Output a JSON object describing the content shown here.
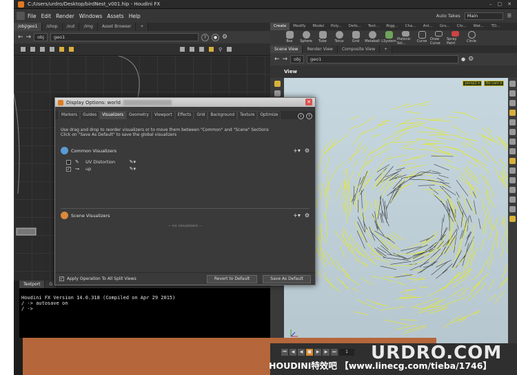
{
  "window": {
    "title": "C:/Users/urdro/Desktop/birdNest_v001.hip - Houdini FX"
  },
  "menu": [
    "File",
    "Edit",
    "Render",
    "Windows",
    "Assets",
    "Help"
  ],
  "top_right": {
    "auto_takes": "Auto Takes",
    "desktop": "Main"
  },
  "left_pane": {
    "tabs": [
      "/obj/geo1",
      "/shop",
      "/out",
      "/img",
      "Asset Browser"
    ],
    "path_obj": "obj",
    "path_geo": "geo1"
  },
  "shelf": {
    "tabs": [
      "Create",
      "Modify",
      "Model",
      "Poly...",
      "Defo...",
      "Text...",
      "Rigg...",
      "Cha...",
      "Anl...",
      "Gro...",
      "Clo...",
      "Wat...",
      "TD..."
    ],
    "tools": [
      "Box",
      "Sphere",
      "Tube",
      "Torus",
      "Grid",
      "Metaball",
      "LSystem",
      "Platonic Sol...",
      "Curve",
      "Draw Curve",
      "Spray Paint",
      "Circle"
    ]
  },
  "right_pane": {
    "tabs": [
      "Scene View",
      "Render View",
      "Composite View"
    ],
    "path_obj": "obj",
    "path_geo": "geo1",
    "view_label": "View",
    "cam_badges": [
      "persp1 ▾",
      "No cam ▾"
    ]
  },
  "dialog": {
    "title": "Display Options: world",
    "tabs": [
      "Markers",
      "Guides",
      "Visualizers",
      "Geometry",
      "Viewport",
      "Effects",
      "Grid",
      "Background",
      "Texture",
      "Optimize"
    ],
    "active_tab": "Visualizers",
    "description_line1": "Use drag and drop to reorder visualizers or to move them between \"Common\" and \"Scene\" Sections",
    "description_line2": "Click on \"Save As Default\" to save the global visualizers",
    "common_label": "Common Visualizers",
    "visualizers": [
      {
        "name": "UV Distortion",
        "checked": false
      },
      {
        "name": "up",
        "checked": true
      }
    ],
    "scene_label": "Scene Visualizers",
    "no_visualizers": "-- no visualizers --",
    "apply_label": "Apply Operation To All Split Views",
    "revert_button": "Revert to Default",
    "save_button": "Save As Default"
  },
  "console": {
    "tabs": [
      "Textport",
      "G"
    ],
    "line1": "Houdini FX Version 14.0.318 (Compiled on Apr 29 2015)",
    "line2": "/ -> autosave on",
    "line3": "/ ->"
  },
  "timeline": {
    "frame": "1"
  },
  "watermark": {
    "brand": "URDRO.COM",
    "sub": "HOUDINI特效吧 【www.linecg.com/tieba/1746】"
  },
  "colors": {
    "accent": "#e07a1f",
    "curve_yellow": "#e9ec1a",
    "viewport_bg": "#c3d3db"
  }
}
